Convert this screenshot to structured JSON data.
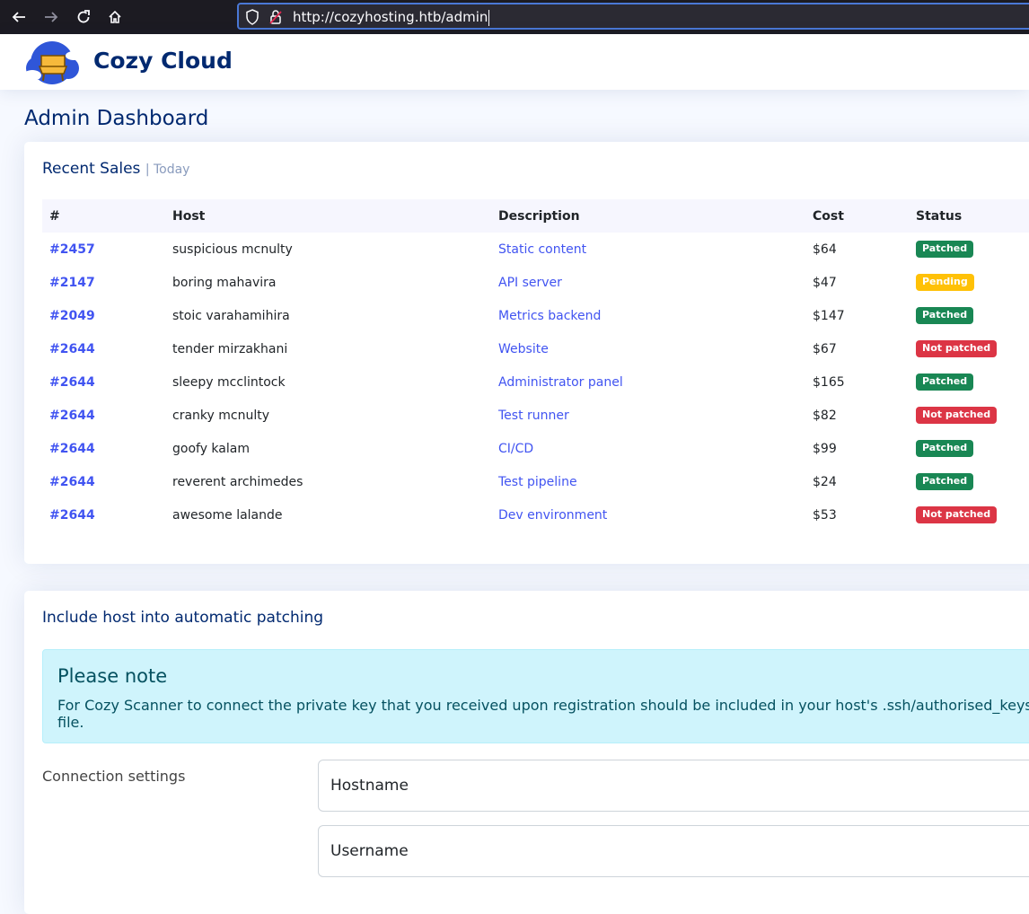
{
  "browser": {
    "url": "http://cozyhosting.htb/admin",
    "icons": [
      "back-arrow-icon",
      "forward-arrow-icon",
      "reload-icon",
      "home-icon",
      "shield-icon",
      "lock-icon"
    ]
  },
  "header": {
    "brand": "Cozy Cloud"
  },
  "page": {
    "title": "Admin Dashboard"
  },
  "sales": {
    "title": "Recent Sales",
    "subtitle": "| Today",
    "columns": [
      "#",
      "Host",
      "Description",
      "Cost",
      "Status"
    ],
    "rows": [
      {
        "id": "#2457",
        "host": "suspicious mcnulty",
        "description": "Static content",
        "cost": "$64",
        "status": "Patched",
        "status_type": "patched"
      },
      {
        "id": "#2147",
        "host": "boring mahavira",
        "description": "API server",
        "cost": "$47",
        "status": "Pending",
        "status_type": "pending"
      },
      {
        "id": "#2049",
        "host": "stoic varahamihira",
        "description": "Metrics backend",
        "cost": "$147",
        "status": "Patched",
        "status_type": "patched"
      },
      {
        "id": "#2644",
        "host": "tender mirzakhani",
        "description": "Website",
        "cost": "$67",
        "status": "Not patched",
        "status_type": "notpatched"
      },
      {
        "id": "#2644",
        "host": "sleepy mcclintock",
        "description": "Administrator panel",
        "cost": "$165",
        "status": "Patched",
        "status_type": "patched"
      },
      {
        "id": "#2644",
        "host": "cranky mcnulty",
        "description": "Test runner",
        "cost": "$82",
        "status": "Not patched",
        "status_type": "notpatched"
      },
      {
        "id": "#2644",
        "host": "goofy kalam",
        "description": "CI/CD",
        "cost": "$99",
        "status": "Patched",
        "status_type": "patched"
      },
      {
        "id": "#2644",
        "host": "reverent archimedes",
        "description": "Test pipeline",
        "cost": "$24",
        "status": "Patched",
        "status_type": "patched"
      },
      {
        "id": "#2644",
        "host": "awesome lalande",
        "description": "Dev environment",
        "cost": "$53",
        "status": "Not patched",
        "status_type": "notpatched"
      }
    ]
  },
  "patching": {
    "title": "Include host into automatic patching",
    "alert_heading": "Please note",
    "alert_body": "For Cozy Scanner to connect the private key that you received upon registration should be included in your host's .ssh/authorised_keys file.",
    "connection_label": "Connection settings",
    "hostname_placeholder": "Hostname",
    "username_placeholder": "Username"
  },
  "colors": {
    "brand": "#012970",
    "link": "#4154f1",
    "patched": "#198754",
    "pending": "#ffc107",
    "not_patched": "#dc3545",
    "alert_bg": "#cff4fc"
  }
}
